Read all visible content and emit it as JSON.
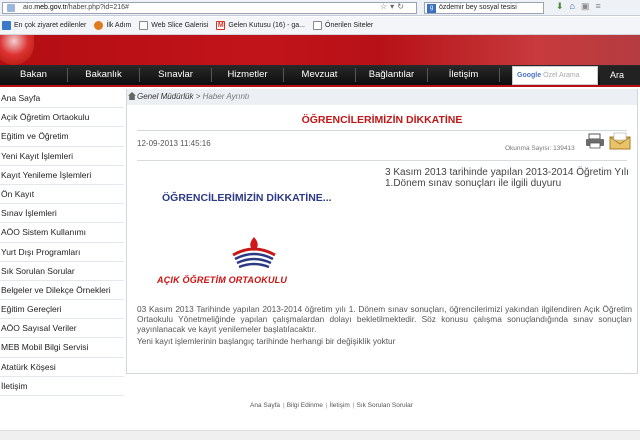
{
  "browser": {
    "url_prefix": "aio.",
    "url_host": "meb.gov.tr",
    "url_path": "/haber.php?id=216#",
    "search_engine_letter": "g",
    "search_query": "özdemir bey sosyal tesisi",
    "bookmarks": [
      {
        "label": "En çok ziyaret edilenler",
        "icon": "folder-icon",
        "color": "#3a79c8"
      },
      {
        "label": "İlk Adım",
        "icon": "firefox-icon",
        "color": "#e07a1f"
      },
      {
        "label": "Web Slice Galerisi",
        "icon": "page-icon",
        "color": "#ffffff"
      },
      {
        "label": "Gelen Kutusu (16) - ga...",
        "icon": "gmail-icon",
        "color": "#d93025"
      },
      {
        "label": "Önerilen Siteler",
        "icon": "page-icon",
        "color": "#ffffff"
      }
    ]
  },
  "nav": {
    "items": [
      "Bakan",
      "Bakanlık",
      "Sınavlar",
      "Hizmetler",
      "Mevzuat",
      "Bağlantılar",
      "İletişim"
    ],
    "search_brand": "Google",
    "search_placeholder": "Özel Arama",
    "search_button": "Ara"
  },
  "sidebar": {
    "items": [
      "Ana Sayfa",
      "Açık Öğretim Ortaokulu",
      "Eğitim ve Öğretim",
      "Yeni Kayıt İşlemleri",
      "Kayıt Yenileme İşlemleri",
      "Ön Kayıt",
      "Sınav İşlemleri",
      "AÖO Sistem Kullanımı",
      "Yurt Dışı Programları",
      "Sık Sorulan Sorular",
      "Belgeler ve Dilekçe Örnekleri",
      "Eğitim Gereçleri",
      "AÖO Sayısal Veriler",
      "MEB Mobil Bilgi Servisi",
      "Atatürk Köşesi",
      "İletişim"
    ]
  },
  "article": {
    "breadcrumb_1": "Genel Müdürlük",
    "breadcrumb_sep": " > ",
    "breadcrumb_2": "Haber Ayrıntı",
    "title": "ÖĞRENCİLERİMİZİN DİKKATİNE",
    "date": "12-09-2013 11:45:16",
    "views_label": "Okunma Sayısı:",
    "views_count": "139413",
    "summary_line1": "3 Kasım 2013 tarihinde yapılan 2013-2014 Öğretim Yılı",
    "summary_line2": "1.Dönem sınav sonuçları ile ilgili duyuru",
    "image_title": "ÖĞRENCİLERİMİZİN DİKKATİNE...",
    "logo_text": "AÇIK ÖĞRETİM ORTAOKULU",
    "body_paragraph": "03 Kasım 2013 Tarihinde yapılan 2013-2014 öğretim yılı 1. Dönem sınav sonuçları, öğrencilerimizi yakından ilgilendiren Açık Öğretim Ortaokulu Yönetmeliğinde yapılan çalışmalardan dolayı bekletilmektedir. Söz konusu çalışma sonuçlandığında sınav sonuçları yayınlanacak ve kayıt yenilemeler başlatılacaktır.",
    "body_paragraph2": "Yeni kayıt işlemlerinin başlangıç tarihinde herhangi bir değişiklik yoktur"
  },
  "footer": {
    "links": [
      "Ana Sayfa",
      "Bilgi Edinme",
      "İletişim",
      "Sık Sorulan Sorular"
    ],
    "separator": "|"
  }
}
